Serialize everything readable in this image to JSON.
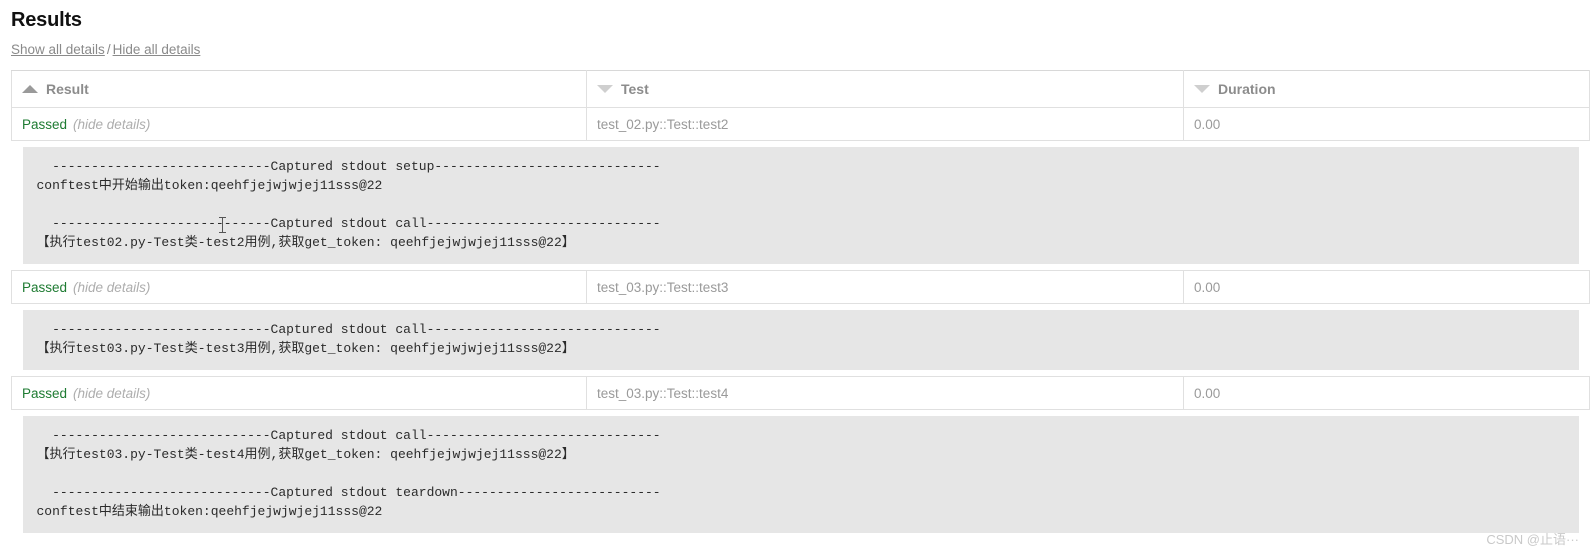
{
  "page": {
    "title": "Results"
  },
  "controls": {
    "show_all": "Show all details",
    "separator": "/",
    "hide_all": "Hide all details"
  },
  "table": {
    "columns": [
      {
        "label": "Result",
        "sort": "asc",
        "icon": "triangle-up-icon"
      },
      {
        "label": "Test",
        "sort": "none",
        "icon": "triangle-down-icon"
      },
      {
        "label": "Duration",
        "sort": "none",
        "icon": "triangle-down-icon"
      }
    ],
    "rows": [
      {
        "status": "Passed",
        "toggle": "(hide details)",
        "test": "test_02.py::Test::test2",
        "duration": "0.00",
        "detail": "  ----------------------------Captured stdout setup-----------------------------\nconftest中开始输出token:qeehfjejwjwjej11sss@22\n\n  ----------------------------Captured stdout call------------------------------\n【执行test02.py-Test类-test2用例,获取get_token: qeehfjejwjwjej11sss@22】"
      },
      {
        "status": "Passed",
        "toggle": "(hide details)",
        "test": "test_03.py::Test::test3",
        "duration": "0.00",
        "detail": "  ----------------------------Captured stdout call------------------------------\n【执行test03.py-Test类-test3用例,获取get_token: qeehfjejwjwjej11sss@22】"
      },
      {
        "status": "Passed",
        "toggle": "(hide details)",
        "test": "test_03.py::Test::test4",
        "duration": "0.00",
        "detail": "  ----------------------------Captured stdout call------------------------------\n【执行test03.py-Test类-test4用例,获取get_token: qeehfjejwjwjej11sss@22】\n\n  ----------------------------Captured stdout teardown--------------------------\nconftest中结束输出token:qeehfjejwjwjej11sss@22"
      }
    ]
  },
  "watermark": {
    "text": "CSDN @止语···"
  },
  "colors": {
    "passed_green": "#1e7b32",
    "muted_gray": "#9a9a9a",
    "detail_background": "#e6e6e6",
    "border": "#e0e0e0"
  }
}
